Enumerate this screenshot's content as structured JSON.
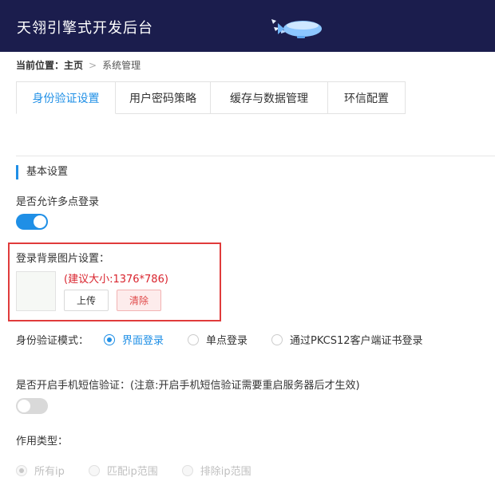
{
  "header": {
    "title": "天翎引擎式开发后台"
  },
  "breadcrumb": {
    "prefix": "当前位置：",
    "home": "主页",
    "separator": ">",
    "current": "系统管理"
  },
  "tabs": [
    {
      "label": "身份验证设置",
      "active": true
    },
    {
      "label": "用户密码策略",
      "active": false
    },
    {
      "label": "缓存与数据管理",
      "active": false
    },
    {
      "label": "环信配置",
      "active": false
    }
  ],
  "section": {
    "title": "基本设置"
  },
  "multi_login": {
    "label": "是否允许多点登录",
    "enabled": true
  },
  "login_bg": {
    "label": "登录背景图片设置：",
    "hint": "(建议大小:1376*786)",
    "upload_label": "上传",
    "clear_label": "清除"
  },
  "auth_mode": {
    "label": "身份验证模式：",
    "options": [
      {
        "label": "界面登录",
        "checked": true
      },
      {
        "label": "单点登录",
        "checked": false
      },
      {
        "label": "通过PKCS12客户端证书登录",
        "checked": false
      }
    ]
  },
  "sms": {
    "label": "是否开启手机短信验证：(注意:开启手机短信验证需要重启服务器后才生效)",
    "enabled": false
  },
  "scope": {
    "label": "作用类型：",
    "options": [
      {
        "label": "所有ip",
        "checked": true
      },
      {
        "label": "匹配ip范围",
        "checked": false
      },
      {
        "label": "排除ip范围",
        "checked": false
      }
    ]
  },
  "colors": {
    "header_bg": "#1b1d4d",
    "accent": "#1f8fe6",
    "danger": "#d9232d"
  }
}
